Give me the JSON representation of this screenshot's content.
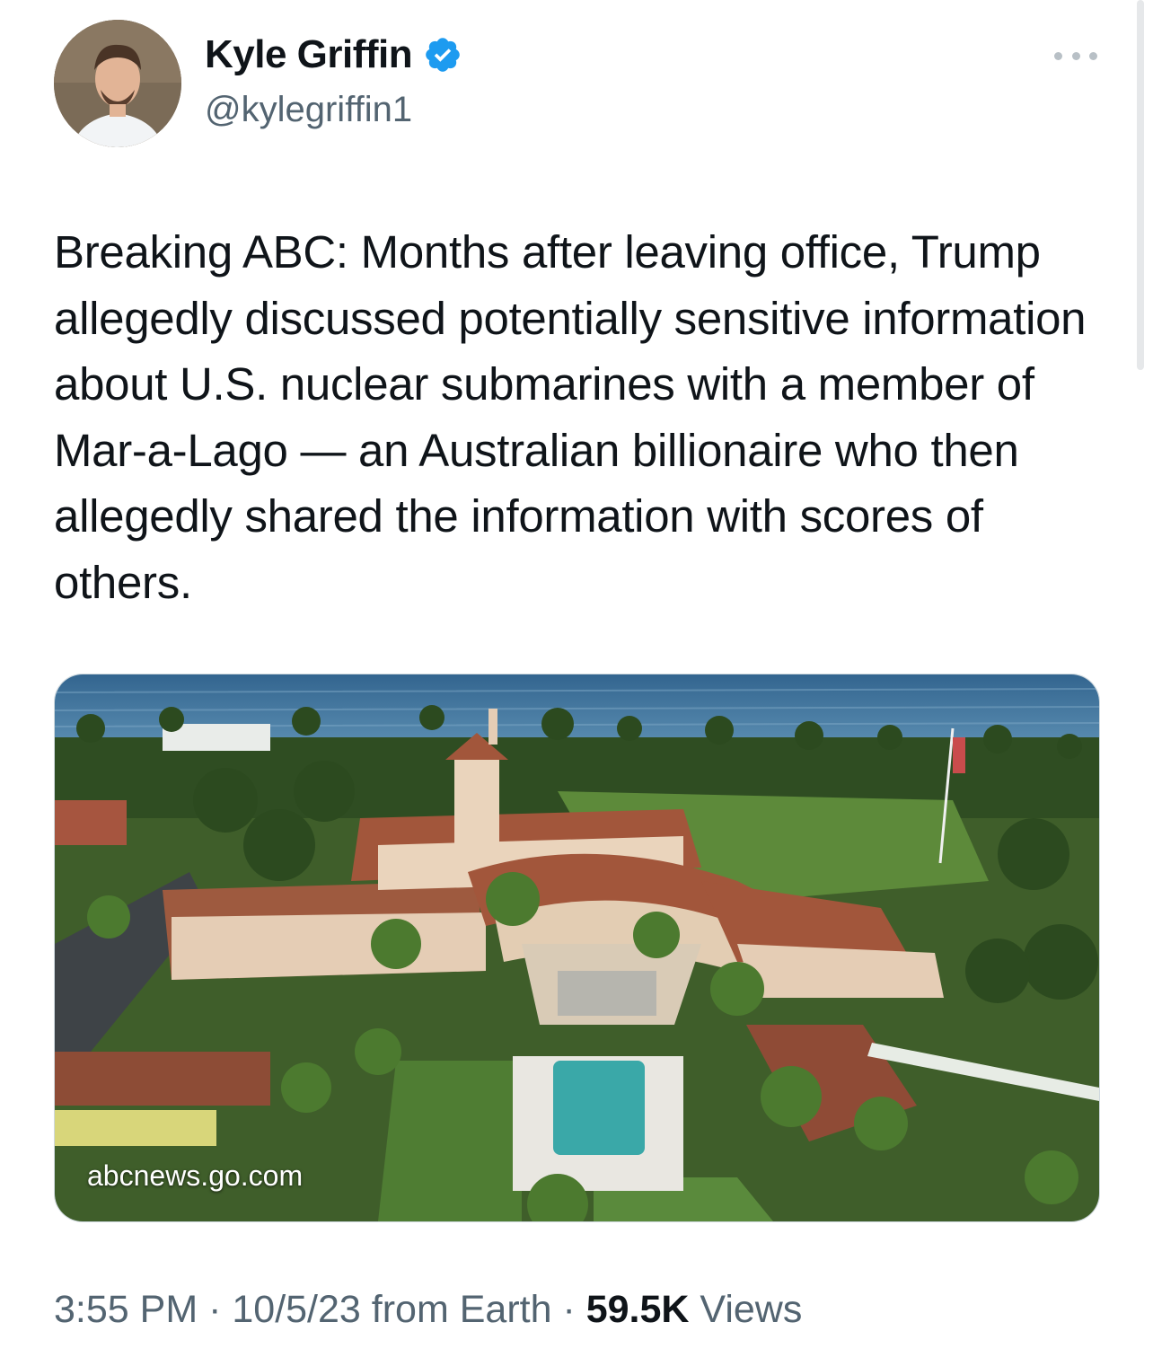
{
  "author": {
    "name": "Kyle Griffin",
    "handle": "@kylegriffin1",
    "verified": true,
    "verified_color": "#1d9bf0"
  },
  "tweet": {
    "text": "Breaking ABC: Months after leaving office, Trump allegedly discussed potentially sensitive information about U.S. nuclear submarines with a member of Mar-a-Lago — an Australian billionaire who then allegedly shared the information with scores of others."
  },
  "card": {
    "domain": "abcnews.go.com"
  },
  "meta": {
    "time": "3:55 PM",
    "sep1": " · ",
    "date": "10/5/23",
    "source": " from Earth",
    "sep2": " · ",
    "views_count": "59.5K",
    "views_label": " Views"
  },
  "icons": {
    "more": "more-horizontal-icon",
    "verified": "verified-badge-icon"
  }
}
